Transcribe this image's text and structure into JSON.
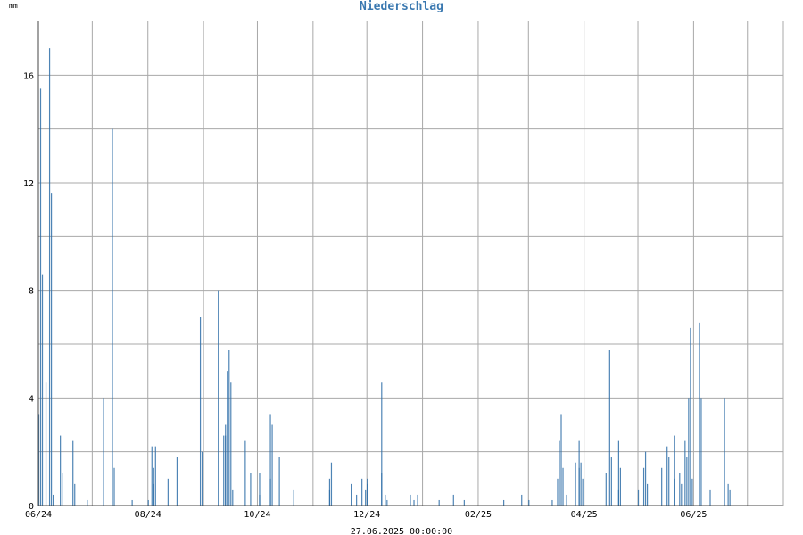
{
  "chart_data": {
    "type": "bar",
    "title": "Niederschlag",
    "ylabel": "mm",
    "xlabel": "27.06.2025 00:00:00",
    "ylim": [
      0,
      18
    ],
    "yticks": [
      0,
      4,
      8,
      12,
      16
    ],
    "grid": true,
    "x_start": "2024-06-01",
    "x_end": "2025-07-21",
    "xticks": [
      {
        "label": "06/24",
        "date": "2024-06-01"
      },
      {
        "label": "08/24",
        "date": "2024-08-01"
      },
      {
        "label": "10/24",
        "date": "2024-10-01"
      },
      {
        "label": "12/24",
        "date": "2024-12-01"
      },
      {
        "label": "02/25",
        "date": "2025-02-01"
      },
      {
        "label": "04/25",
        "date": "2025-04-01"
      },
      {
        "label": "06/25",
        "date": "2025-06-01"
      }
    ],
    "colors": {
      "title": "#3a78b0",
      "bars": "#2f6fa8",
      "grid": "#a8a8a8",
      "axis": "#444444"
    },
    "series": [
      {
        "values": [
          [
            "2024-06-01",
            3.4
          ],
          [
            "2024-06-02",
            15.5
          ],
          [
            "2024-06-03",
            8.6
          ],
          [
            "2024-06-05",
            4.6
          ],
          [
            "2024-06-07",
            17.0
          ],
          [
            "2024-06-08",
            11.6
          ],
          [
            "2024-06-09",
            0.4
          ],
          [
            "2024-06-13",
            2.6
          ],
          [
            "2024-06-14",
            1.2
          ],
          [
            "2024-06-20",
            2.4
          ],
          [
            "2024-06-21",
            0.8
          ],
          [
            "2024-06-28",
            0.2
          ],
          [
            "2024-07-07",
            4.0
          ],
          [
            "2024-07-12",
            14.0
          ],
          [
            "2024-07-13",
            1.4
          ],
          [
            "2024-07-23",
            0.2
          ],
          [
            "2024-08-01",
            0.2
          ],
          [
            "2024-08-03",
            2.2
          ],
          [
            "2024-08-04",
            1.4
          ],
          [
            "2024-08-05",
            2.2
          ],
          [
            "2024-08-04",
            0.8
          ],
          [
            "2024-08-12",
            1.0
          ],
          [
            "2024-08-17",
            1.8
          ],
          [
            "2024-08-30",
            7.0
          ],
          [
            "2024-08-31",
            2.0
          ],
          [
            "2024-09-09",
            8.0
          ],
          [
            "2024-09-12",
            2.6
          ],
          [
            "2024-09-13",
            2.6
          ],
          [
            "2024-09-14",
            5.0
          ],
          [
            "2024-09-15",
            5.8
          ],
          [
            "2024-09-16",
            4.6
          ],
          [
            "2024-09-17",
            0.6
          ],
          [
            "2024-09-13",
            3.0
          ],
          [
            "2024-09-24",
            2.4
          ],
          [
            "2024-09-27",
            1.2
          ],
          [
            "2024-10-02",
            1.2
          ],
          [
            "2024-10-02",
            0.4
          ],
          [
            "2024-10-08",
            3.4
          ],
          [
            "2024-10-09",
            3.0
          ],
          [
            "2024-10-08",
            1.0
          ],
          [
            "2024-10-13",
            1.8
          ],
          [
            "2024-10-21",
            0.6
          ],
          [
            "2024-11-10",
            1.0
          ],
          [
            "2024-11-11",
            1.6
          ],
          [
            "2024-11-10",
            0.6
          ],
          [
            "2024-11-22",
            0.8
          ],
          [
            "2024-11-25",
            0.4
          ],
          [
            "2024-11-28",
            1.0
          ],
          [
            "2024-11-30",
            0.6
          ],
          [
            "2024-12-01",
            0.8
          ],
          [
            "2024-12-01",
            1.0
          ],
          [
            "2024-12-09",
            4.6
          ],
          [
            "2024-12-09",
            1.2
          ],
          [
            "2024-12-11",
            0.4
          ],
          [
            "2024-12-12",
            0.2
          ],
          [
            "2024-12-25",
            0.4
          ],
          [
            "2024-12-27",
            0.2
          ],
          [
            "2024-12-29",
            0.4
          ],
          [
            "2025-01-10",
            0.2
          ],
          [
            "2025-01-18",
            0.4
          ],
          [
            "2025-01-24",
            0.2
          ],
          [
            "2025-02-15",
            0.2
          ],
          [
            "2025-02-25",
            0.4
          ],
          [
            "2025-03-01",
            0.2
          ],
          [
            "2025-03-14",
            0.2
          ],
          [
            "2025-03-17",
            1.0
          ],
          [
            "2025-03-18",
            2.4
          ],
          [
            "2025-03-19",
            3.4
          ],
          [
            "2025-03-20",
            1.4
          ],
          [
            "2025-03-22",
            0.4
          ],
          [
            "2025-03-27",
            1.6
          ],
          [
            "2025-03-29",
            2.4
          ],
          [
            "2025-03-30",
            1.6
          ],
          [
            "2025-03-31",
            1.0
          ],
          [
            "2025-03-29",
            1.4
          ],
          [
            "2025-04-13",
            1.2
          ],
          [
            "2025-04-15",
            5.8
          ],
          [
            "2025-04-16",
            1.8
          ],
          [
            "2025-04-20",
            2.4
          ],
          [
            "2025-04-21",
            1.4
          ],
          [
            "2025-04-20",
            0.6
          ],
          [
            "2025-05-01",
            0.6
          ],
          [
            "2025-05-04",
            1.4
          ],
          [
            "2025-05-05",
            2.0
          ],
          [
            "2025-05-06",
            0.8
          ],
          [
            "2025-05-14",
            1.4
          ],
          [
            "2025-05-17",
            2.2
          ],
          [
            "2025-05-18",
            1.8
          ],
          [
            "2025-05-21",
            2.6
          ],
          [
            "2025-05-21",
            1.0
          ],
          [
            "2025-05-24",
            1.2
          ],
          [
            "2025-05-25",
            0.8
          ],
          [
            "2025-05-27",
            2.4
          ],
          [
            "2025-05-28",
            1.8
          ],
          [
            "2025-05-29",
            4.0
          ],
          [
            "2025-05-30",
            6.6
          ],
          [
            "2025-05-31",
            1.0
          ],
          [
            "2025-06-04",
            6.8
          ],
          [
            "2025-06-05",
            4.0
          ],
          [
            "2025-06-10",
            0.6
          ],
          [
            "2025-06-18",
            4.0
          ],
          [
            "2025-06-20",
            0.8
          ],
          [
            "2025-06-21",
            0.6
          ]
        ]
      }
    ]
  }
}
